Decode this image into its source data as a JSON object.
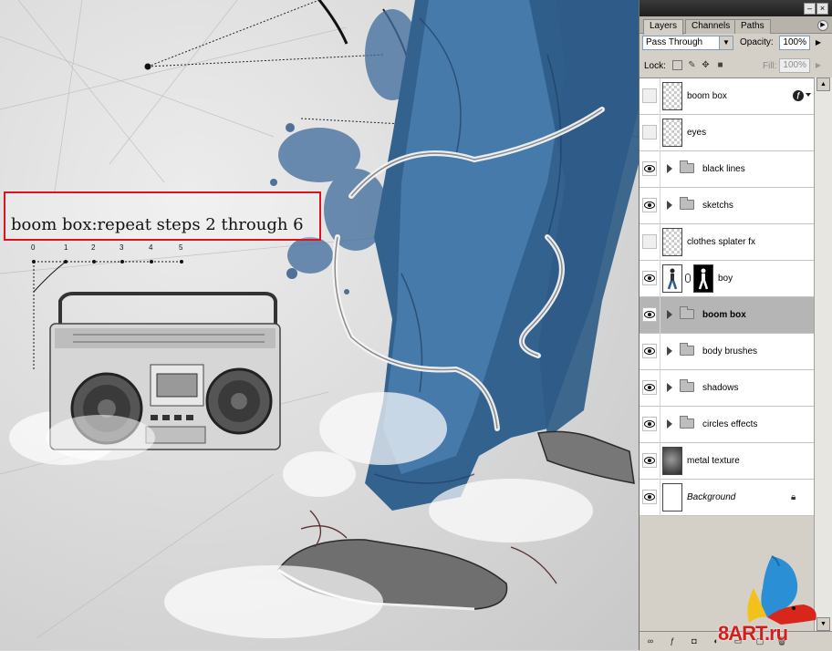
{
  "annotation": {
    "text": "boom box:repeat steps 2 through 6"
  },
  "ruler": {
    "ticks": [
      "0",
      "1",
      "2",
      "3",
      "4",
      "5"
    ]
  },
  "panel": {
    "tabs": [
      {
        "label": "Layers",
        "active": true
      },
      {
        "label": "Channels",
        "active": false
      },
      {
        "label": "Paths",
        "active": false
      }
    ],
    "blend_mode": "Pass Through",
    "opacity_label": "Opacity:",
    "opacity_value": "100%",
    "lock_label": "Lock:",
    "fill_label": "Fill:",
    "fill_value": "100%",
    "layers": [
      {
        "name": "boom box",
        "kind": "layer",
        "visible": false,
        "has_fx": true
      },
      {
        "name": "eyes",
        "kind": "layer",
        "visible": false
      },
      {
        "name": "black lines",
        "kind": "group",
        "visible": true
      },
      {
        "name": "sketchs",
        "kind": "group",
        "visible": true
      },
      {
        "name": "clothes splater fx",
        "kind": "layer",
        "visible": false
      },
      {
        "name": "boy",
        "kind": "masked-layer",
        "visible": true
      },
      {
        "name": "boom box",
        "kind": "group",
        "visible": true,
        "selected": true
      },
      {
        "name": "body brushes",
        "kind": "group",
        "visible": true
      },
      {
        "name": "shadows",
        "kind": "group",
        "visible": true
      },
      {
        "name": "circles effects",
        "kind": "group",
        "visible": true
      },
      {
        "name": "metal texture",
        "kind": "layer",
        "visible": true
      },
      {
        "name": "Background",
        "kind": "background",
        "visible": true,
        "locked": true
      }
    ]
  },
  "watermark": {
    "text": "8ART.ru"
  }
}
